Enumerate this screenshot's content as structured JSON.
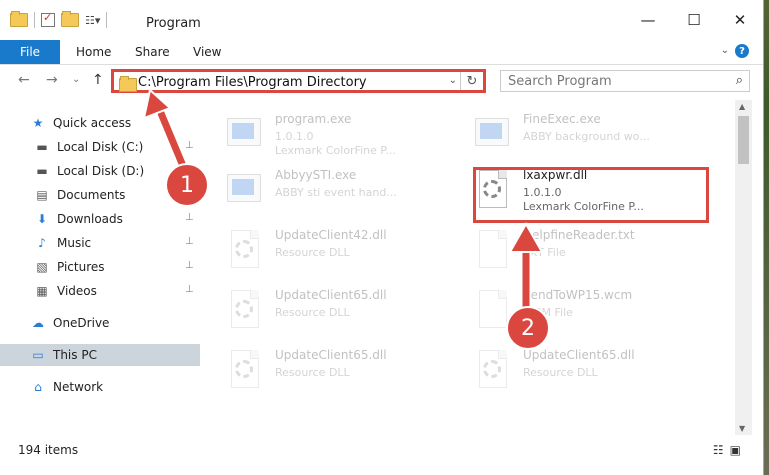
{
  "window": {
    "title": "Program",
    "minimize_icon": "minimize-icon",
    "maximize_icon": "maximize-icon",
    "close_icon": "close-icon"
  },
  "ribbon": {
    "tabs": [
      "File",
      "Home",
      "Share",
      "View"
    ],
    "accent": "#1979ca"
  },
  "navigation": {
    "back": "←",
    "forward": "→",
    "recent": "⌄",
    "up": "↑"
  },
  "address": {
    "path": "C:\\Program Files\\Program Directory"
  },
  "search": {
    "placeholder": "Search Program"
  },
  "sidebar": {
    "items": [
      {
        "label": "Quick access",
        "icon": "star-icon",
        "pinned": false
      },
      {
        "label": "Local Disk (C:)",
        "icon": "drive-icon",
        "pinned": true
      },
      {
        "label": "Local Disk (D:)",
        "icon": "drive-icon",
        "pinned": true
      },
      {
        "label": "Documents",
        "icon": "documents-icon",
        "pinned": true
      },
      {
        "label": "Downloads",
        "icon": "download-icon",
        "pinned": true
      },
      {
        "label": "Music",
        "icon": "music-icon",
        "pinned": true
      },
      {
        "label": "Pictures",
        "icon": "pictures-icon",
        "pinned": true
      },
      {
        "label": "Videos",
        "icon": "videos-icon",
        "pinned": true
      },
      {
        "label": "OneDrive",
        "icon": "cloud-icon",
        "pinned": false
      },
      {
        "label": "This PC",
        "icon": "computer-icon",
        "pinned": false,
        "selected": true
      },
      {
        "label": "Network",
        "icon": "network-icon",
        "pinned": false
      }
    ]
  },
  "files": [
    {
      "name": "program.exe",
      "line2": "1.0.1.0",
      "line3": "Lexmark ColorFine P...",
      "icon": "application-icon",
      "faded": true
    },
    {
      "name": "FineExec.exe",
      "line2": "ABBY background wo...",
      "line3": "",
      "icon": "application-icon",
      "faded": true
    },
    {
      "name": "AbbyySTI.exe",
      "line2": "ABBY sti event hand...",
      "line3": "",
      "icon": "application-icon",
      "faded": true
    },
    {
      "name": "lxaxpwr.dll",
      "line2": "1.0.1.0",
      "line3": "Lexmark ColorFine P...",
      "icon": "dll-gear-icon",
      "faded": false
    },
    {
      "name": "UpdateClient42.dll",
      "line2": "Resource DLL",
      "line3": "",
      "icon": "dll-gear-icon",
      "faded": true
    },
    {
      "name": "HelpfineReader.txt",
      "line2": "TXT File",
      "line3": "",
      "icon": "text-file-icon",
      "faded": true
    },
    {
      "name": "UpdateClient65.dll",
      "line2": "Resource DLL",
      "line3": "",
      "icon": "dll-gear-icon",
      "faded": true
    },
    {
      "name": "SendToWP15.wcm",
      "line2": "WCM File",
      "line3": "",
      "icon": "file-icon",
      "faded": true
    },
    {
      "name": "UpdateClient65.dll",
      "line2": "Resource DLL",
      "line3": "",
      "icon": "dll-gear-icon",
      "faded": true
    },
    {
      "name": "UpdateClient65.dll",
      "line2": "Resource DLL",
      "line3": "",
      "icon": "dll-gear-icon",
      "faded": true
    }
  ],
  "status": {
    "item_count": "194 items"
  },
  "annotations": {
    "step1": "1",
    "step2": "2",
    "color": "#d9473f"
  }
}
